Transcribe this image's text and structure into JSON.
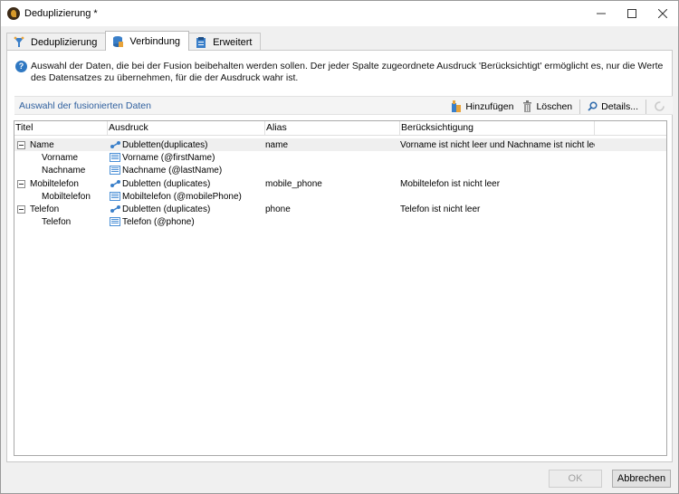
{
  "window": {
    "title": "Deduplizierung *",
    "controls": {
      "minimize": "—",
      "maximize": "☐",
      "close": "✕"
    }
  },
  "tabs": [
    {
      "label": "Deduplizierung",
      "icon": "funnel-icon",
      "active": false
    },
    {
      "label": "Verbindung",
      "icon": "database-icon",
      "active": true
    },
    {
      "label": "Erweitert",
      "icon": "clipboard-icon",
      "active": false
    }
  ],
  "info": {
    "text": "Auswahl der Daten, die bei der Fusion beibehalten werden sollen. Der jeder Spalte zugeordnete Ausdruck 'Berücksichtigt' ermöglicht es, nur die Werte des Datensatzes zu übernehmen, für die der Ausdruck wahr ist."
  },
  "section": {
    "title": "Auswahl der fusionierten Daten",
    "toolbar": {
      "add": "Hinzufügen",
      "delete": "Löschen",
      "details": "Details..."
    }
  },
  "grid": {
    "columns": [
      "Titel",
      "Ausdruck",
      "Alias",
      "Berücksichtigung"
    ],
    "rows": [
      {
        "title": "Name",
        "expression": "Dubletten(duplicates)",
        "alias": "name",
        "condition": "Vorname ist nicht leer und Nachname ist nicht leer",
        "level": 0,
        "icon": "link-icon",
        "selected": true
      },
      {
        "title": "Vorname",
        "expression": "Vorname (@firstName)",
        "alias": "",
        "condition": "",
        "level": 1,
        "icon": "field-icon"
      },
      {
        "title": "Nachname",
        "expression": "Nachname (@lastName)",
        "alias": "",
        "condition": "",
        "level": 1,
        "icon": "field-icon"
      },
      {
        "title": "Mobiltelefon",
        "expression": "Dubletten (duplicates)",
        "alias": "mobile_phone",
        "condition": "Mobiltelefon ist nicht leer",
        "level": 0,
        "icon": "link-icon"
      },
      {
        "title": "Mobiltelefon",
        "expression": "Mobiltelefon (@mobilePhone)",
        "alias": "",
        "condition": "",
        "level": 1,
        "icon": "field-icon"
      },
      {
        "title": "Telefon",
        "expression": "Dubletten (duplicates)",
        "alias": "phone",
        "condition": "Telefon ist nicht leer",
        "level": 0,
        "icon": "link-icon"
      },
      {
        "title": "Telefon",
        "expression": "Telefon (@phone)",
        "alias": "",
        "condition": "",
        "level": 1,
        "icon": "field-icon"
      }
    ]
  },
  "footer": {
    "ok": "OK",
    "cancel": "Abbrechen"
  }
}
